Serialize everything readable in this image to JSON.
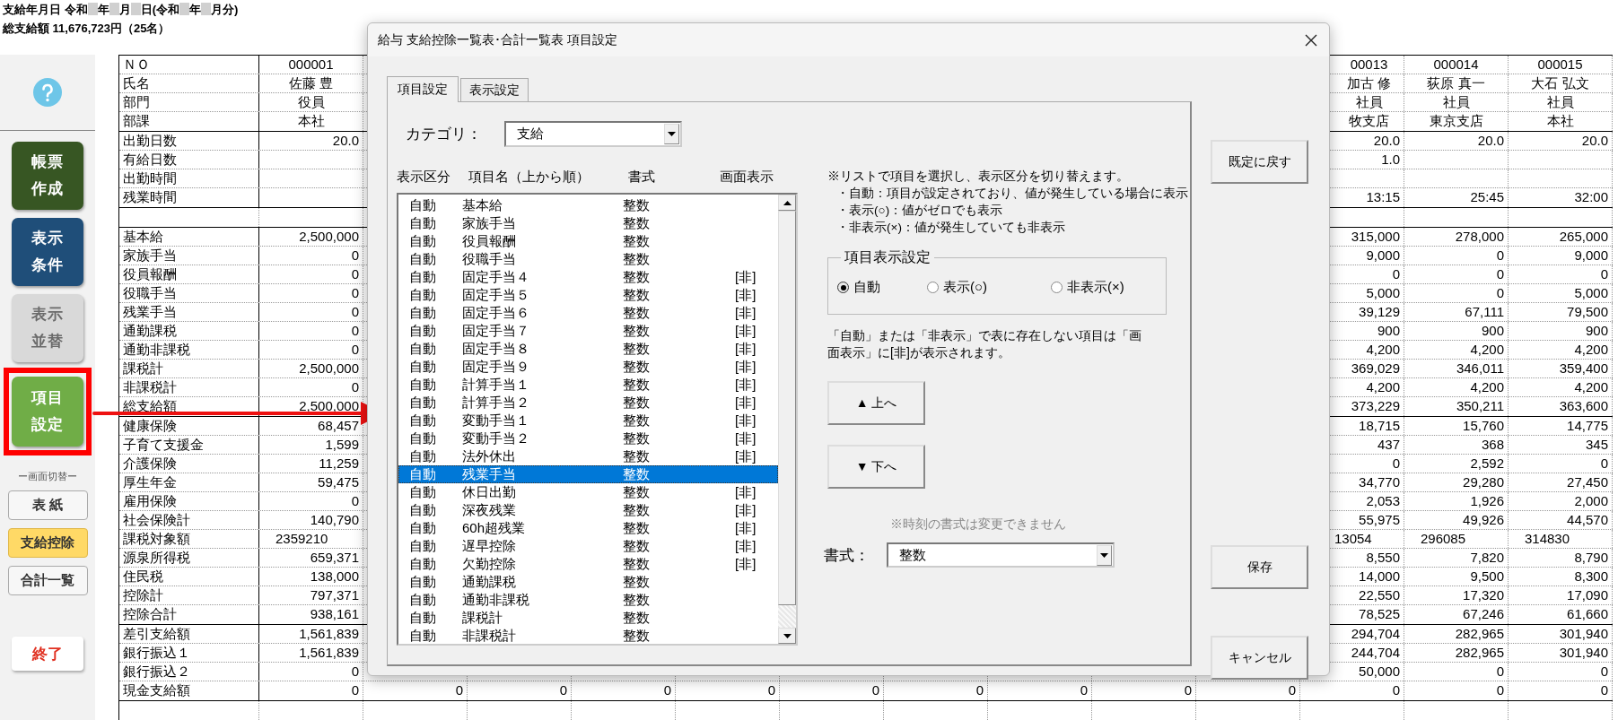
{
  "header": {
    "pay_date_parts": [
      "支給年月日 令和",
      "年",
      "月",
      "日(令和",
      "年",
      "月分)"
    ],
    "total": "総支給額 11,676,723円（25名）"
  },
  "sidebar": {
    "main_buttons": [
      {
        "label": "帳票作成",
        "color": "#375623",
        "highlighted": false
      },
      {
        "label": "表示条件",
        "color": "#1f4e79",
        "highlighted": false
      },
      {
        "label": "表示並替",
        "color": "#d9d9d9",
        "highlighted": false,
        "disabled": true
      },
      {
        "label": "項目設定",
        "color": "#70ad47",
        "highlighted": true
      }
    ],
    "switch_caption": "ー画面切替ー",
    "views": [
      {
        "label": "表 紙",
        "selected": false
      },
      {
        "label": "支給控除",
        "selected": true
      },
      {
        "label": "合計一覧",
        "selected": false
      }
    ],
    "exit_button": "終了"
  },
  "table": {
    "sections": [
      {
        "kind": "header",
        "rows": [
          {
            "label": "ＮＯ",
            "values": {
              "col_1": "000001",
              "col_13": "00013",
              "col_14": "000014",
              "col_15": "000015"
            }
          },
          {
            "label": "氏名",
            "values": {
              "col_1": "佐藤 豊",
              "col_13": "加古 修",
              "col_14": "荻原 真一",
              "col_15": "大石 弘文"
            }
          },
          {
            "label": "部門",
            "values": {
              "col_1": "役員",
              "col_13": "社員",
              "col_14": "社員",
              "col_15": "社員"
            }
          },
          {
            "label": "部課",
            "values": {
              "col_1": "本社",
              "col_13": "牧支店",
              "col_14": "東京支店",
              "col_15": "本社"
            }
          }
        ]
      },
      {
        "kind": "data",
        "rows": [
          {
            "label": "出勤日数",
            "values": {
              "col_1": "20.0",
              "col_13": "20.0",
              "col_14": "20.0",
              "col_15": "20.0"
            }
          },
          {
            "label": "有給日数",
            "values": {
              "col_13": "1.0"
            }
          },
          {
            "label": "出勤時間",
            "values": {}
          },
          {
            "label": "残業時間",
            "values": {
              "col_13": "13:15",
              "col_14": "25:45",
              "col_15": "32:00"
            }
          }
        ]
      },
      {
        "kind": "spacer"
      },
      {
        "kind": "data",
        "rows": [
          {
            "label": "基本給",
            "values": {
              "col_1": "2,500,000",
              "col_13": "315,000",
              "col_14": "278,000",
              "col_15": "265,000"
            }
          },
          {
            "label": "家族手当",
            "values": {
              "col_1": "0",
              "col_13": "9,000",
              "col_14": "0",
              "col_15": "9,000"
            }
          },
          {
            "label": "役員報酬",
            "values": {
              "col_1": "0",
              "col_13": "0",
              "col_14": "0",
              "col_15": "0"
            }
          },
          {
            "label": "役職手当",
            "values": {
              "col_1": "0",
              "col_13": "5,000",
              "col_14": "0",
              "col_15": "5,000"
            }
          },
          {
            "label": "残業手当",
            "values": {
              "col_1": "0",
              "col_13": "39,129",
              "col_14": "67,111",
              "col_15": "79,500"
            }
          },
          {
            "label": "通勤課税",
            "values": {
              "col_1": "0",
              "col_13": "900",
              "col_14": "900",
              "col_15": "900"
            }
          },
          {
            "label": "通勤非課税",
            "values": {
              "col_1": "0",
              "col_13": "4,200",
              "col_14": "4,200",
              "col_15": "4,200"
            }
          },
          {
            "label": "課税計",
            "values": {
              "col_1": "2,500,000",
              "col_13": "369,029",
              "col_14": "346,011",
              "col_15": "359,400"
            }
          },
          {
            "label": "非課税計",
            "values": {
              "col_1": "0",
              "col_13": "4,200",
              "col_14": "4,200",
              "col_15": "4,200"
            }
          },
          {
            "label": "総支給額",
            "values": {
              "col_1": "2,500,000",
              "col_13": "373,229",
              "col_14": "350,211",
              "col_15": "363,600"
            }
          }
        ]
      },
      {
        "kind": "data",
        "rows": [
          {
            "label": "健康保険",
            "values": {
              "col_1": "68,457",
              "col_13": "18,715",
              "col_14": "15,760",
              "col_15": "14,775"
            }
          },
          {
            "label": "子育て支援金",
            "values": {
              "col_1": "1,599",
              "col_13": "437",
              "col_14": "368",
              "col_15": "345"
            }
          },
          {
            "label": "介護保険",
            "values": {
              "col_1": "11,259",
              "col_13": "0",
              "col_14": "2,592",
              "col_15": "0"
            }
          },
          {
            "label": "厚生年金",
            "values": {
              "col_1": "59,475",
              "col_13": "34,770",
              "col_14": "29,280",
              "col_15": "27,450"
            }
          },
          {
            "label": "雇用保険",
            "values": {
              "col_1": "0",
              "col_13": "2,053",
              "col_14": "1,926",
              "col_15": "2,000"
            }
          },
          {
            "label": "社会保険計",
            "values": {
              "col_1": "140,790",
              "col_13": "55,975",
              "col_14": "49,926",
              "col_15": "44,570"
            }
          },
          {
            "label": "課税対象額",
            "kind": "raw",
            "values": {
              "col_1": "2359210",
              "col_13": "13054",
              "col_14": "296085",
              "col_15": "314830"
            }
          },
          {
            "label": "源泉所得税",
            "values": {
              "col_1": "659,371",
              "col_13": "8,550",
              "col_14": "7,820",
              "col_15": "8,790"
            }
          },
          {
            "label": "住民税",
            "values": {
              "col_1": "138,000",
              "col_13": "14,000",
              "col_14": "9,500",
              "col_15": "8,300"
            }
          },
          {
            "label": "控除計",
            "values": {
              "col_1": "797,371",
              "col_13": "22,550",
              "col_14": "17,320",
              "col_15": "17,090"
            }
          },
          {
            "label": "控除合計",
            "values": {
              "col_1": "938,161",
              "col_13": "78,525",
              "col_14": "67,246",
              "col_15": "61,660"
            }
          }
        ]
      },
      {
        "kind": "data",
        "rows": [
          {
            "label": "差引支給額",
            "values": {
              "col_1": "1,561,839",
              "col_13": "294,704",
              "col_14": "282,965",
              "col_15": "301,940"
            }
          },
          {
            "label": "銀行振込１",
            "values": {
              "col_1": "1,561,839",
              "col_13": "244,704",
              "col_14": "282,965",
              "col_15": "301,940"
            }
          },
          {
            "label": "銀行振込２",
            "values": {
              "col_1": "0",
              "col_13": "50,000",
              "col_14": "0",
              "col_15": "0"
            }
          },
          {
            "label": "現金支給額",
            "values": {
              "col_1": "0",
              "col_13": "0",
              "col_14": "0",
              "col_15": "0"
            },
            "middle": [
              "0",
              "0",
              "0",
              "0",
              "0",
              "0",
              "0",
              "0",
              "0"
            ]
          }
        ]
      },
      {
        "kind": "spacer"
      }
    ]
  },
  "dialog": {
    "title": "給与 支給控除一覧表･合計一覧表 項目設定",
    "tabs": [
      {
        "label": "項目設定",
        "selected": true
      },
      {
        "label": "表示設定",
        "selected": false
      }
    ],
    "category": {
      "label": "カテゴリ：",
      "value": "支給"
    },
    "list_headers": [
      "表示区分",
      "項目名（上から順）",
      "書式",
      "画面表示"
    ],
    "items": [
      {
        "display": "自動",
        "name": "基本給",
        "format": "整数",
        "selected": false
      },
      {
        "display": "自動",
        "name": "家族手当",
        "format": "整数",
        "selected": false
      },
      {
        "display": "自動",
        "name": "役員報酬",
        "format": "整数",
        "selected": false
      },
      {
        "display": "自動",
        "name": "役職手当",
        "format": "整数",
        "selected": false
      },
      {
        "display": "自動",
        "name": "固定手当４",
        "format": "整数",
        "screen": "[非]",
        "selected": false
      },
      {
        "display": "自動",
        "name": "固定手当５",
        "format": "整数",
        "screen": "[非]",
        "selected": false
      },
      {
        "display": "自動",
        "name": "固定手当６",
        "format": "整数",
        "screen": "[非]",
        "selected": false
      },
      {
        "display": "自動",
        "name": "固定手当７",
        "format": "整数",
        "screen": "[非]",
        "selected": false
      },
      {
        "display": "自動",
        "name": "固定手当８",
        "format": "整数",
        "screen": "[非]",
        "selected": false
      },
      {
        "display": "自動",
        "name": "固定手当９",
        "format": "整数",
        "screen": "[非]",
        "selected": false
      },
      {
        "display": "自動",
        "name": "計算手当１",
        "format": "整数",
        "screen": "[非]",
        "selected": false
      },
      {
        "display": "自動",
        "name": "計算手当２",
        "format": "整数",
        "screen": "[非]",
        "selected": false
      },
      {
        "display": "自動",
        "name": "変動手当１",
        "format": "整数",
        "screen": "[非]",
        "selected": false
      },
      {
        "display": "自動",
        "name": "変動手当２",
        "format": "整数",
        "screen": "[非]",
        "selected": false
      },
      {
        "display": "自動",
        "name": "法外休出",
        "format": "整数",
        "screen": "[非]",
        "selected": false
      },
      {
        "display": "自動",
        "name": "残業手当",
        "format": "整数",
        "selected": true
      },
      {
        "display": "自動",
        "name": "休日出勤",
        "format": "整数",
        "screen": "[非]",
        "selected": false
      },
      {
        "display": "自動",
        "name": "深夜残業",
        "format": "整数",
        "screen": "[非]",
        "selected": false
      },
      {
        "display": "自動",
        "name": "60h超残業",
        "format": "整数",
        "screen": "[非]",
        "selected": false
      },
      {
        "display": "自動",
        "name": "遅早控除",
        "format": "整数",
        "screen": "[非]",
        "selected": false
      },
      {
        "display": "自動",
        "name": "欠勤控除",
        "format": "整数",
        "screen": "[非]",
        "selected": false
      },
      {
        "display": "自動",
        "name": "通勤課税",
        "format": "整数",
        "selected": false
      },
      {
        "display": "自動",
        "name": "通勤非課税",
        "format": "整数",
        "selected": false
      },
      {
        "display": "自動",
        "name": "課税計",
        "format": "整数",
        "selected": false
      },
      {
        "display": "自動",
        "name": "非課税計",
        "format": "整数",
        "selected": false
      }
    ],
    "notes": [
      "※リストで項目を選択し、表示区分を切り替えます。",
      "・自動：項目が設定されており、値が発生している場合に表示",
      "・表示(○)：値がゼロでも表示",
      "・非表示(×)：値が発生していても非表示"
    ],
    "display_setting": {
      "title": "項目表示設定",
      "options": [
        {
          "label": "自動",
          "selected": true
        },
        {
          "label": "表示(○)",
          "selected": false
        },
        {
          "label": "非表示(×)",
          "selected": false
        }
      ]
    },
    "legend_note": "「自動」または「非表示」で表に存在しない項目は「画面表示」に[非]が表示されます。",
    "up_button": "▲ 上へ",
    "down_button": "▼ 下へ",
    "format_note": "※時刻の書式は変更できません",
    "format": {
      "label": "書式：",
      "value": "整数"
    },
    "side_buttons": [
      "既定に戻す",
      "保存",
      "キャンセル"
    ]
  }
}
